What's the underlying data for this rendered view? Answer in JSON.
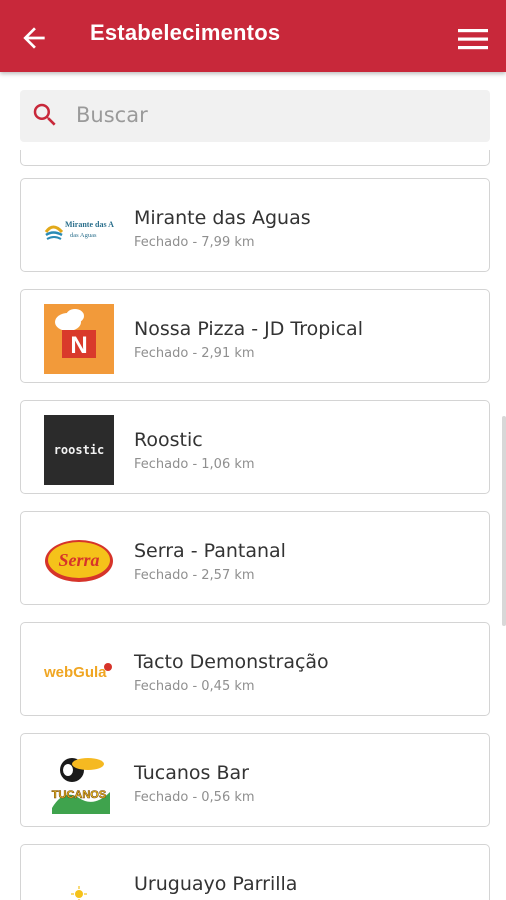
{
  "header": {
    "title": "Estabelecimentos",
    "back_icon": "arrow-left-icon",
    "menu_icon": "hamburger-menu-icon",
    "background": "#c8283a"
  },
  "search": {
    "placeholder": "Buscar",
    "icon": "search-icon",
    "icon_color": "#c8283a"
  },
  "establishments": [
    {
      "name": "Mirante das Aguas",
      "status": "Fechado",
      "distance": "7,99 km",
      "status_line": "Fechado - 7,99 km",
      "logo_text": "Mirante das Aguas"
    },
    {
      "name": "Nossa Pizza - JD Tropical",
      "status": "Fechado",
      "distance": "2,91 km",
      "status_line": "Fechado - 2,91 km",
      "logo_text": "N"
    },
    {
      "name": "Roostic",
      "status": "Fechado",
      "distance": "1,06 km",
      "status_line": "Fechado - 1,06 km",
      "logo_text": "roostic"
    },
    {
      "name": "Serra - Pantanal",
      "status": "Fechado",
      "distance": "2,57 km",
      "status_line": "Fechado - 2,57 km",
      "logo_text": "Serra"
    },
    {
      "name": "Tacto Demonstração",
      "status": "Fechado",
      "distance": "0,45 km",
      "status_line": "Fechado - 0,45 km",
      "logo_text": "webGula"
    },
    {
      "name": "Tucanos Bar",
      "status": "Fechado",
      "distance": "0,56 km",
      "status_line": "Fechado - 0,56 km",
      "logo_text": "TUCANOS"
    },
    {
      "name": "Uruguayo Parrilla",
      "status": "",
      "distance": "",
      "status_line": "",
      "logo_text": ""
    }
  ]
}
